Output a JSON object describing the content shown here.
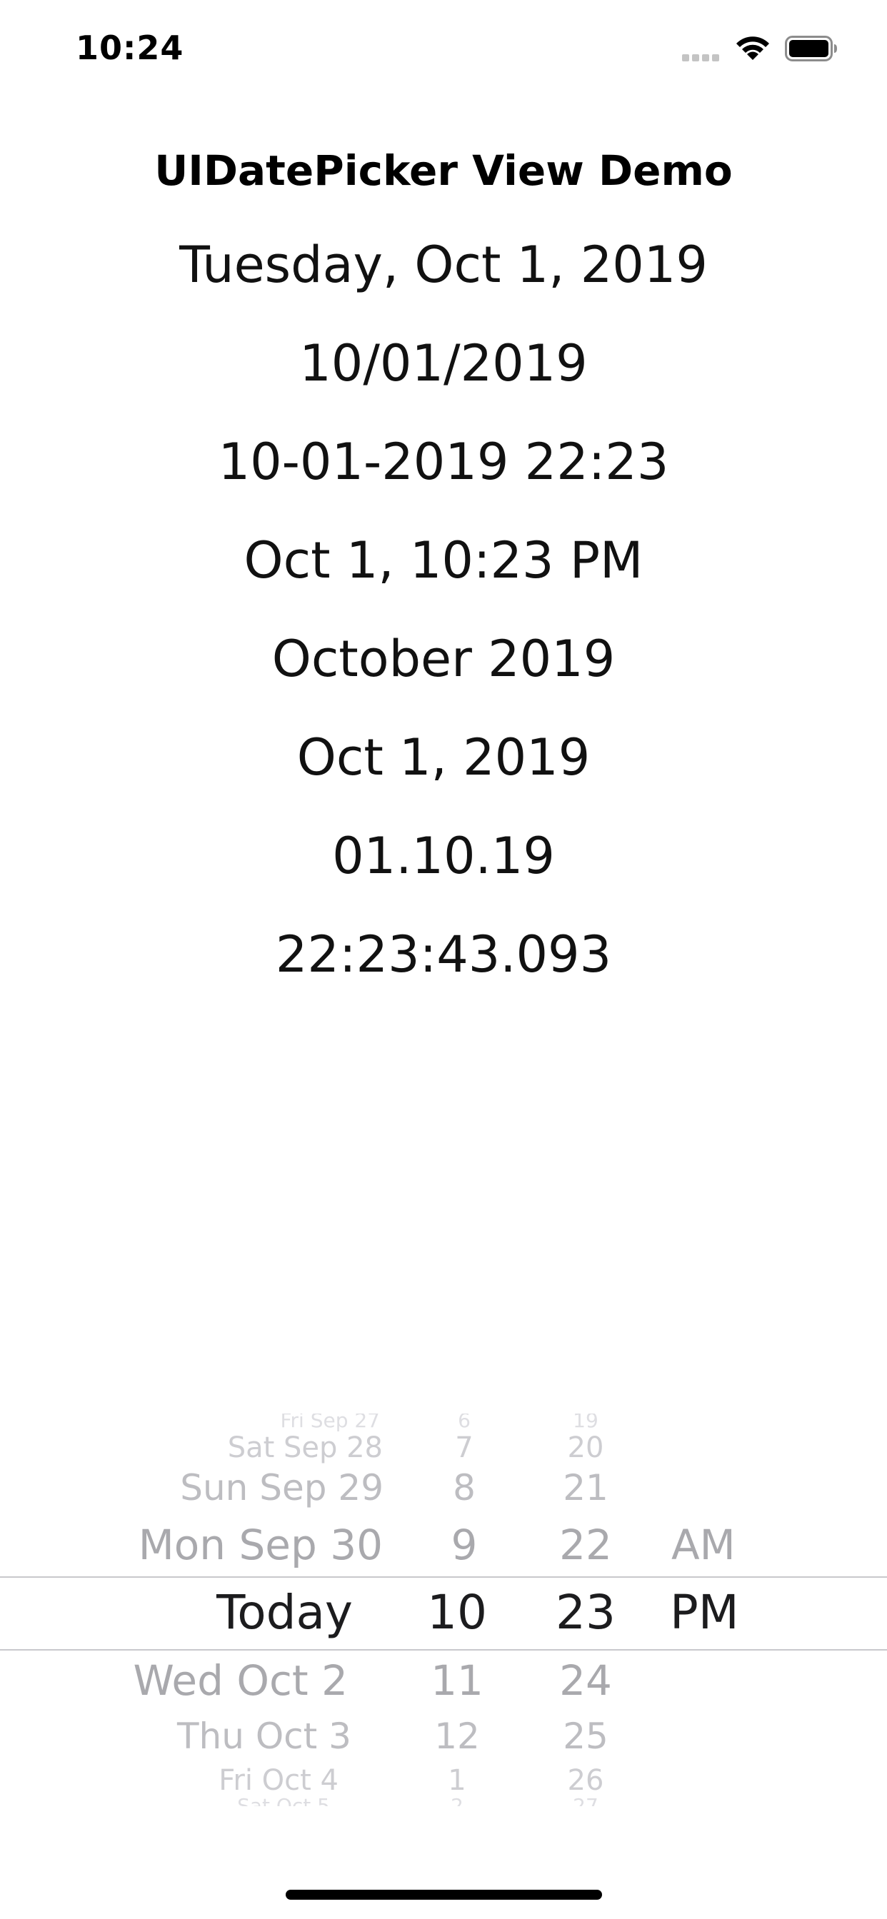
{
  "status_bar": {
    "time": "10:24"
  },
  "title": "UIDatePicker View Demo",
  "date_labels": [
    "Tuesday, Oct 1, 2019",
    "10/01/2019",
    "10-01-2019 22:23",
    "Oct 1, 10:23 PM",
    "October 2019",
    "Oct 1, 2019",
    "01.10.19",
    "22:23:43.093"
  ],
  "picker": {
    "day_column": [
      "Fri Sep 27",
      "Sat Sep 28",
      "Sun Sep 29",
      "Mon Sep 30",
      "Today",
      "Wed Oct 2",
      "Thu Oct 3",
      "Fri Oct 4",
      "Sat Oct 5"
    ],
    "hour_column": [
      "6",
      "7",
      "8",
      "9",
      "10",
      "11",
      "12",
      "1",
      "2"
    ],
    "minute_column": [
      "19",
      "20",
      "21",
      "22",
      "23",
      "24",
      "25",
      "26",
      "27"
    ],
    "ampm_column": [
      "AM",
      "PM"
    ],
    "selected": {
      "day": "Today",
      "hour": "10",
      "minute": "23",
      "ampm": "PM"
    }
  }
}
